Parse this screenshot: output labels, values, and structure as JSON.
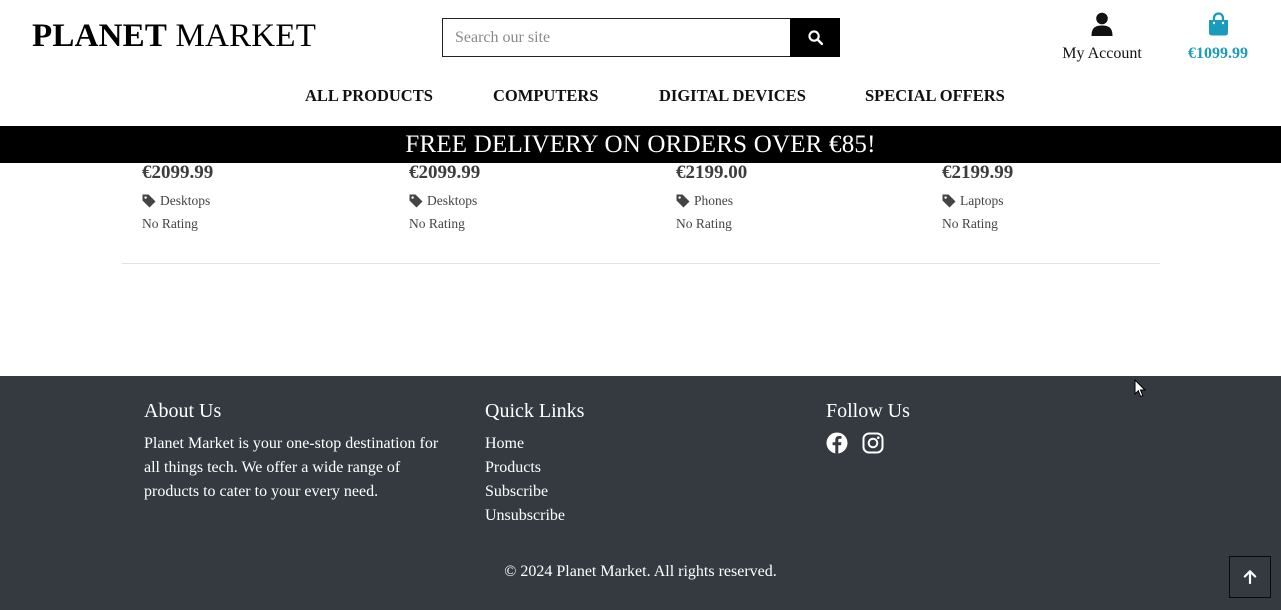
{
  "logo": {
    "bold": "PLANET",
    "normal": "MARKET"
  },
  "search": {
    "placeholder": "Search our site",
    "value": ""
  },
  "account": {
    "label": "My Account",
    "icon": "user-icon"
  },
  "cart": {
    "total": "€1099.99",
    "icon": "shopping-bag-icon",
    "color": "#1a9bbd"
  },
  "nav": {
    "items": [
      {
        "label": "ALL PRODUCTS"
      },
      {
        "label": "COMPUTERS"
      },
      {
        "label": "DIGITAL DEVICES"
      },
      {
        "label": "SPECIAL OFFERS"
      }
    ]
  },
  "banner": {
    "text": "FREE DELIVERY ON ORDERS OVER €85!"
  },
  "products": [
    {
      "price": "€2099.99",
      "category": "Desktops",
      "rating": "No Rating"
    },
    {
      "price": "€2099.99",
      "category": "Desktops",
      "rating": "No Rating"
    },
    {
      "price": "€2199.00",
      "category": "Phones",
      "rating": "No Rating"
    },
    {
      "price": "€2199.99",
      "category": "Laptops",
      "rating": "No Rating"
    }
  ],
  "footer": {
    "about": {
      "title": "About Us",
      "text": "Planet Market is your one-stop destination for all things tech. We offer a wide range of products to cater to your every need."
    },
    "quick_links": {
      "title": "Quick Links",
      "items": [
        {
          "label": "Home"
        },
        {
          "label": "Products"
        },
        {
          "label": "Subscribe"
        },
        {
          "label": "Unsubscribe"
        }
      ]
    },
    "follow": {
      "title": "Follow Us",
      "icons": [
        "facebook-icon",
        "instagram-icon"
      ]
    },
    "copyright": "© 2024 Planet Market. All rights reserved.",
    "background": "#343a40"
  }
}
